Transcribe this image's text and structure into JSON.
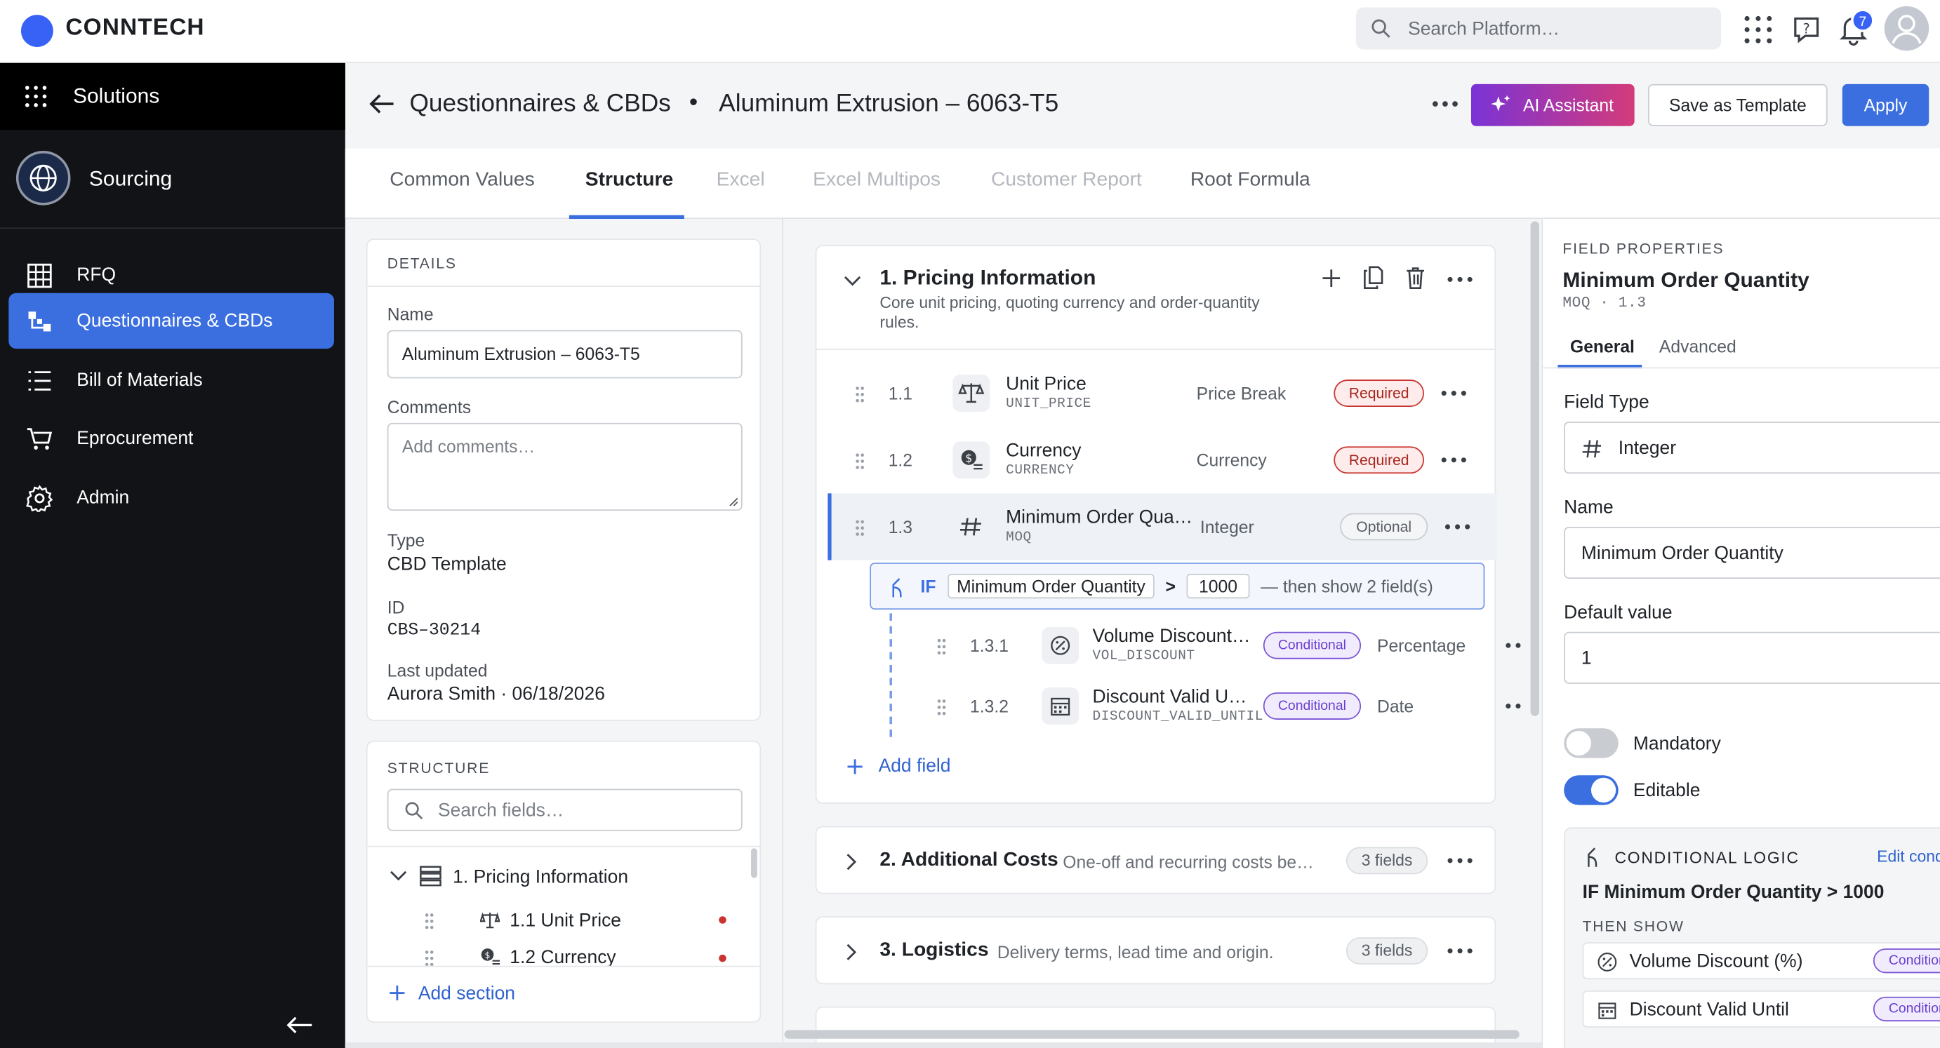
{
  "app": {
    "brand": "CONNTECH",
    "search_placeholder": "Search Platform…",
    "notifications": "7"
  },
  "sidebar": {
    "solutions": "Solutions",
    "sourcing": "Sourcing",
    "items": [
      {
        "label": "RFQ",
        "icon": "grid-icon"
      },
      {
        "label": "Questionnaires & CBDs",
        "icon": "flow-icon",
        "active": true
      },
      {
        "label": "Bill of Materials",
        "icon": "list-icon"
      },
      {
        "label": "Eprocurement",
        "icon": "cart-icon"
      },
      {
        "label": "Admin",
        "icon": "gear-icon"
      }
    ]
  },
  "header": {
    "crumb": "Questionnaires & CBDs",
    "separator": "•",
    "title": "Aluminum Extrusion – 6063-T5",
    "ai_label": "AI Assistant",
    "save_label": "Save as Template",
    "apply_label": "Apply"
  },
  "tabs": [
    "Common Values",
    "Structure",
    "Excel",
    "Excel Multipos",
    "Customer Report",
    "Root Formula"
  ],
  "details": {
    "header": "DETAILS",
    "name_label": "Name",
    "name_value": "Aluminum Extrusion – 6063-T5",
    "comments_label": "Comments",
    "comments_placeholder": "Add comments…",
    "type_label": "Type",
    "type_value": "CBD Template",
    "id_label": "ID",
    "id_value": "CBS–30214",
    "updated_label": "Last updated",
    "updated_value": "Aurora Smith · 06/18/2026"
  },
  "structure": {
    "header": "STRUCTURE",
    "search_placeholder": "Search fields…",
    "section": "1. Pricing Information",
    "items": [
      "1.1 Unit Price",
      "1.2 Currency"
    ],
    "add_section": "Add section"
  },
  "section1": {
    "title": "1. Pricing Information",
    "desc1": "Core unit pricing, quoting currency and order-quantity",
    "desc2": "rules.",
    "fields": [
      {
        "num": "1.1",
        "name": "Unit Price",
        "code": "UNIT_PRICE",
        "type": "Price Break",
        "status": "Required"
      },
      {
        "num": "1.2",
        "name": "Currency",
        "code": "CURRENCY",
        "type": "Currency",
        "status": "Required"
      },
      {
        "num": "1.3",
        "name": "Minimum Order Qua…",
        "code": "MOQ",
        "type": "Integer",
        "status": "Optional"
      }
    ],
    "condition": {
      "if": "IF",
      "field": "Minimum Order Quantity",
      "op": ">",
      "value": "1000",
      "then": "— then show 2 field(s)"
    },
    "subfields": [
      {
        "num": "1.3.1",
        "name": "Volume Discount…",
        "code": "VOL_DISCOUNT",
        "status": "Conditional",
        "type": "Percentage"
      },
      {
        "num": "1.3.2",
        "name": "Discount Valid U…",
        "code": "DISCOUNT_VALID_UNTIL",
        "status": "Conditional",
        "type": "Date"
      }
    ],
    "add_field": "Add field"
  },
  "section2": {
    "title": "2. Additional Costs",
    "desc": "One-off and recurring costs be…",
    "count": "3 fields"
  },
  "section3": {
    "title": "3. Logistics",
    "desc": "Delivery terms, lead time and origin.",
    "count": "3 fields"
  },
  "props": {
    "header": "FIELD PROPERTIES",
    "title": "Minimum Order Quantity",
    "sub": "MOQ · 1.3",
    "tab_general": "General",
    "tab_advanced": "Advanced",
    "type_label": "Field Type",
    "type_value": "Integer",
    "name_label": "Name",
    "name_value": "Minimum Order Quantity",
    "default_label": "Default value",
    "default_value": "1",
    "mandatory": "Mandatory",
    "mandatory_on": false,
    "editable": "Editable",
    "editable_on": true,
    "cond_header": "CONDITIONAL LOGIC",
    "cond_edit": "Edit conditions",
    "cond_rule": "IF Minimum Order Quantity > 1000",
    "then_show": "THEN SHOW",
    "then_items": [
      {
        "label": "Volume Discount (%)",
        "tag": "Conditional"
      },
      {
        "label": "Discount Valid Until",
        "tag": "Conditional"
      }
    ]
  },
  "colors": {
    "accent": "#3b6fe0",
    "required": "#c9342f",
    "conditional": "#6a3fd0",
    "sidebar": "#121316"
  }
}
